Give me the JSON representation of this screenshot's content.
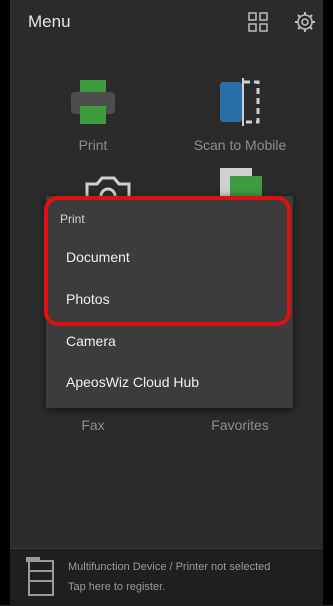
{
  "header": {
    "title": "Menu"
  },
  "tiles": {
    "print": "Print",
    "scan_to_mobile": "Scan to Mobile",
    "fax": "Fax",
    "favorites": "Favorites"
  },
  "popup": {
    "section_label": "Print",
    "items": [
      "Document",
      "Photos",
      "Camera",
      "ApeosWiz Cloud Hub"
    ]
  },
  "footer": {
    "line1": "Multifunction Device / Printer not selected",
    "line2": "Tap here to register."
  },
  "colors": {
    "print_green": "#3f9b3f",
    "scan_blue": "#2a6ea8",
    "highlight_red": "#e01010"
  }
}
